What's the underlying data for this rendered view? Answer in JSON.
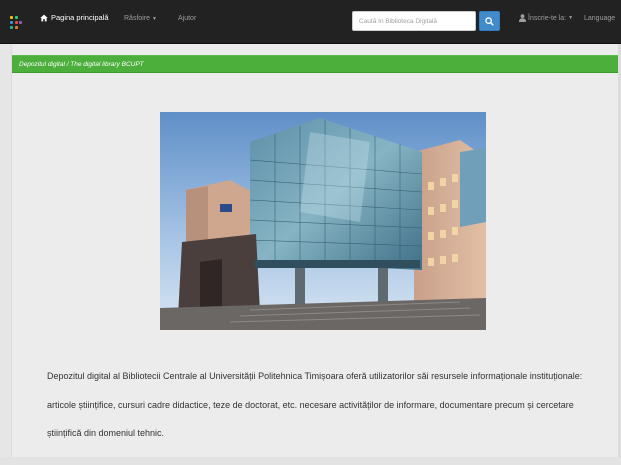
{
  "navbar": {
    "home_label": "Pagina principală",
    "browse_label": "Răsfoire",
    "help_label": "Ajutor",
    "search_placeholder": "Caută în Biblioteca Digitală",
    "login_label": "Înscrie-te la:",
    "language_label": "Language"
  },
  "breadcrumb": {
    "text": "Depozitul digital / The digital library BCUPT"
  },
  "main": {
    "description": "Depozitul digital al Bibliotecii Centrale al Universității Politehnica Timișoara oferă utilizatorilor săi resursele informaționale instituționale: articole științifice, cursuri cadre didactice, teze de doctorat, etc. necesare activităților de informare, documentare precum și cercetare științifică din domeniul tehnic."
  },
  "colors": {
    "navbar_bg": "#222222",
    "accent_green": "#4caf3c",
    "search_button": "#428bca"
  },
  "icons": {
    "logo": "dots-logo-icon",
    "home": "home-icon",
    "search": "search-icon",
    "user": "user-icon",
    "caret": "caret-down-icon"
  }
}
